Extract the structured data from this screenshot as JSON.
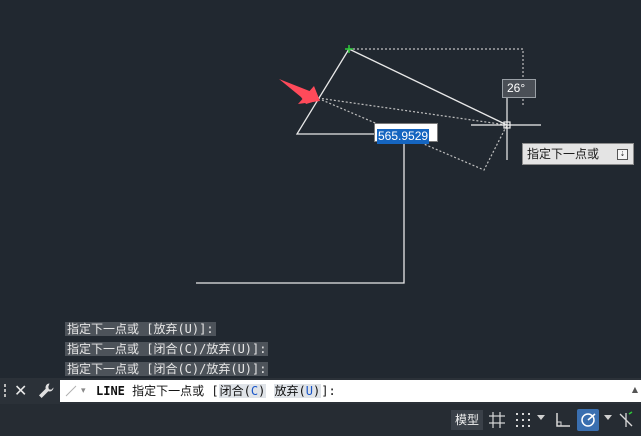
{
  "canvas": {
    "dynamic_input_value": "565.9529",
    "angle_tooltip": "26°",
    "prompt_tooltip": "指定下一点或"
  },
  "command_history": [
    "指定下一点或 [放弃(U)]:",
    "指定下一点或 [闭合(C)/放弃(U)]:",
    "指定下一点或 [闭合(C)/放弃(U)]:"
  ],
  "command_line": {
    "command": "LINE",
    "prompt": "指定下一点或 [",
    "option1_label": "闭合(",
    "option1_key": "C",
    "option1_end": ")",
    "option2_label": "放弃(",
    "option2_key": "U",
    "option2_end": ")",
    "suffix": "]:"
  },
  "status_bar": {
    "model_tab": "模型"
  },
  "colors": {
    "canvas_bg": "#212830",
    "line": "#e8e8e8",
    "accent": "#3a6fb0",
    "arrow": "#ff4a5a"
  }
}
